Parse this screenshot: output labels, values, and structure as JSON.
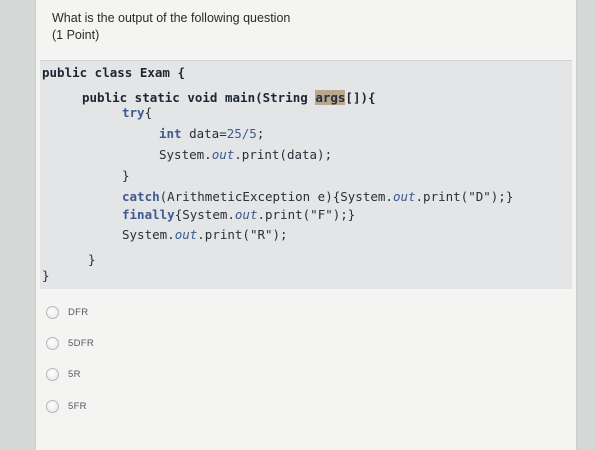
{
  "question": {
    "title": "What is the output of the following question",
    "points": "(1 Point)"
  },
  "code": {
    "line1_kw": "public class",
    "line1_rest": " Exam {",
    "line2_kw": "public static void",
    "line2_mid": " main(String ",
    "line2_hl": "args",
    "line2_end": "[]){",
    "line3_kw": "try",
    "line3_end": "{",
    "line4_kw": "int",
    "line4_mid": " data=",
    "line4_num": "25/5",
    "line4_end": ";",
    "line5_start": "System.",
    "line5_italic": "out",
    "line5_end": ".print(data);",
    "line6": "}",
    "line7_kw": "catch",
    "line7_mid": "(ArithmeticException e){System.",
    "line7_italic": "out",
    "line7_end": ".print(\"D\");}",
    "line8_kw": "finally",
    "line8_mid": "{System.",
    "line8_italic": "out",
    "line8_end": ".print(\"F\");}",
    "line9_start": "System.",
    "line9_italic": "out",
    "line9_end": ".print(\"R\");",
    "line10": "}",
    "line11": "}"
  },
  "options": [
    {
      "label": "DFR"
    },
    {
      "label": "5DFR"
    },
    {
      "label": "5R"
    },
    {
      "label": "5FR"
    }
  ]
}
